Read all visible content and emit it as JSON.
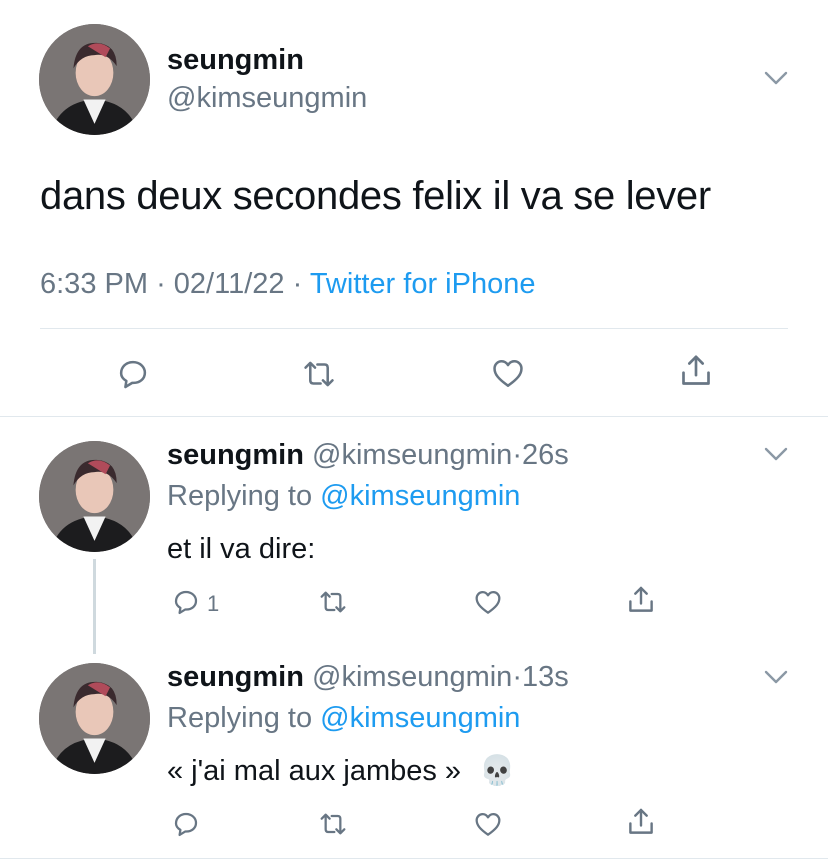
{
  "main_tweet": {
    "author_name": "seungmin",
    "author_handle": "@kimseungmin",
    "text": "dans deux secondes felix il va se lever",
    "time": "6:33 PM",
    "date": "02/11/22",
    "separator": "·",
    "source": "Twitter for iPhone"
  },
  "replies": [
    {
      "author_name": "seungmin",
      "author_handle": "@kimseungmin",
      "separator": "·",
      "age": "26s",
      "replying_prefix": "Replying to",
      "replying_to": "@kimseungmin",
      "text": "et il va dire:",
      "reply_count": "1"
    },
    {
      "author_name": "seungmin",
      "author_handle": "@kimseungmin",
      "separator": "·",
      "age": "13s",
      "replying_prefix": "Replying to",
      "replying_to": "@kimseungmin",
      "text": "« j'ai mal aux jambes »",
      "emoji": "💀",
      "reply_count": ""
    }
  ],
  "icons": {
    "reply": "comment-icon",
    "retweet": "retweet-icon",
    "like": "heart-icon",
    "share": "share-icon",
    "more": "chevron-down-icon"
  },
  "colors": {
    "text": "#0f1419",
    "secondary": "#687684",
    "link": "#1d9bf0",
    "divider": "#e1e8ed"
  }
}
